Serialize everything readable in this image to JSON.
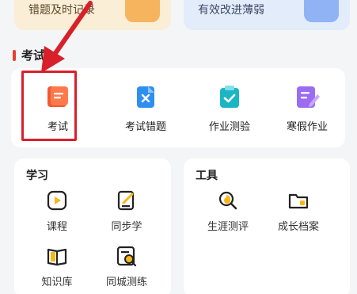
{
  "banners": {
    "left_text": "错题及时记录",
    "right_text": "有效改进薄弱"
  },
  "exam_section": {
    "title": "考试",
    "items": [
      {
        "label": "考试",
        "icon": "exam-book-icon"
      },
      {
        "label": "考试错题",
        "icon": "exam-mistakes-icon"
      },
      {
        "label": "作业测验",
        "icon": "homework-check-icon"
      },
      {
        "label": "寒假作业",
        "icon": "winter-homework-icon"
      }
    ]
  },
  "learn_panel": {
    "title": "学习",
    "items": [
      {
        "label": "课程",
        "icon": "play-course-icon"
      },
      {
        "label": "同步学",
        "icon": "sync-study-icon"
      },
      {
        "label": "知识库",
        "icon": "knowledge-book-icon"
      },
      {
        "label": "同城测练",
        "icon": "local-test-icon"
      }
    ]
  },
  "tools_panel": {
    "title": "工具",
    "items": [
      {
        "label": "生涯测评",
        "icon": "career-search-icon"
      },
      {
        "label": "成长档案",
        "icon": "growth-folder-icon"
      }
    ]
  },
  "colors": {
    "accent_red": "#d8202a",
    "icon_orange": "#f05a35",
    "icon_blue": "#2f8ff0",
    "icon_teal": "#1cb5c4",
    "icon_purple": "#9b6bf2",
    "icon_yellow": "#f7b718"
  }
}
